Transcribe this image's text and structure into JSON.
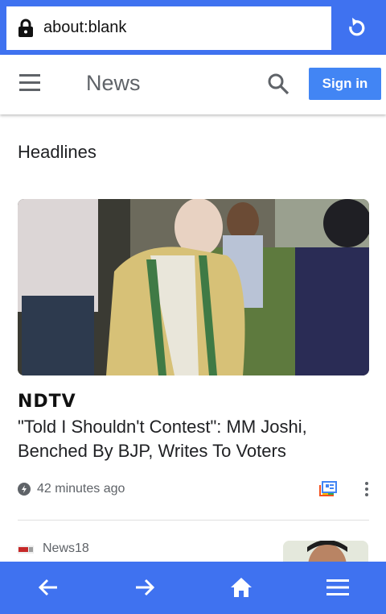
{
  "browser": {
    "url": "about:blank"
  },
  "header": {
    "title": "News",
    "signin_label": "Sign in"
  },
  "section": {
    "title": "Headlines"
  },
  "article1": {
    "source_logo": "NDTV",
    "headline": "\"Told I Shouldn't Contest\": MM Joshi, Benched By BJP, Writes To Voters",
    "time": "42 minutes ago"
  },
  "article2": {
    "source": "News18"
  },
  "icons": {
    "lock": "lock-icon",
    "reload": "reload-icon",
    "menu": "hamburger-menu-icon",
    "search": "search-icon",
    "clock": "clock-icon",
    "full_coverage": "full-coverage-icon",
    "more": "more-vert-icon",
    "back": "arrow-left-icon",
    "forward": "arrow-right-icon",
    "home": "home-icon",
    "browser_menu": "hamburger-menu-icon"
  },
  "colors": {
    "browser_chrome": "#3f72f0",
    "signin": "#4285f4",
    "text_primary": "#202124",
    "text_secondary": "#5f6368"
  }
}
